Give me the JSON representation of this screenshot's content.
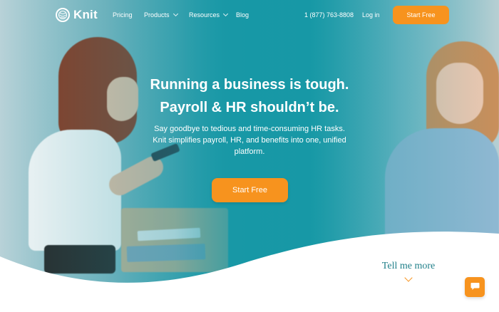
{
  "brand": {
    "name": "Knit",
    "logo_icon": "yarn-ball-icon"
  },
  "nav": {
    "items": [
      {
        "label": "Pricing",
        "has_dropdown": false
      },
      {
        "label": "Products",
        "has_dropdown": true
      },
      {
        "label": "Resources",
        "has_dropdown": true
      },
      {
        "label": "Blog",
        "has_dropdown": false
      }
    ],
    "phone": "1 (877) 763-8808",
    "login": "Log in",
    "cta": "Start Free"
  },
  "hero": {
    "headline_line1": "Running a business is tough.",
    "headline_line2": "Payroll & HR shouldn’t be.",
    "subtext": "Say goodbye to tedious and time-consuming HR tasks. Knit simplifies payroll, HR, and benefits into one, unified platform.",
    "cta": "Start Free"
  },
  "tell_more": {
    "label": "Tell me more",
    "icon": "chevron-down-icon"
  },
  "chat": {
    "icon": "chat-bubble-icon"
  },
  "colors": {
    "accent_orange": "#f7931e",
    "teal": "#179aa6",
    "tell_more_teal": "#1f7f89",
    "white": "#ffffff"
  }
}
